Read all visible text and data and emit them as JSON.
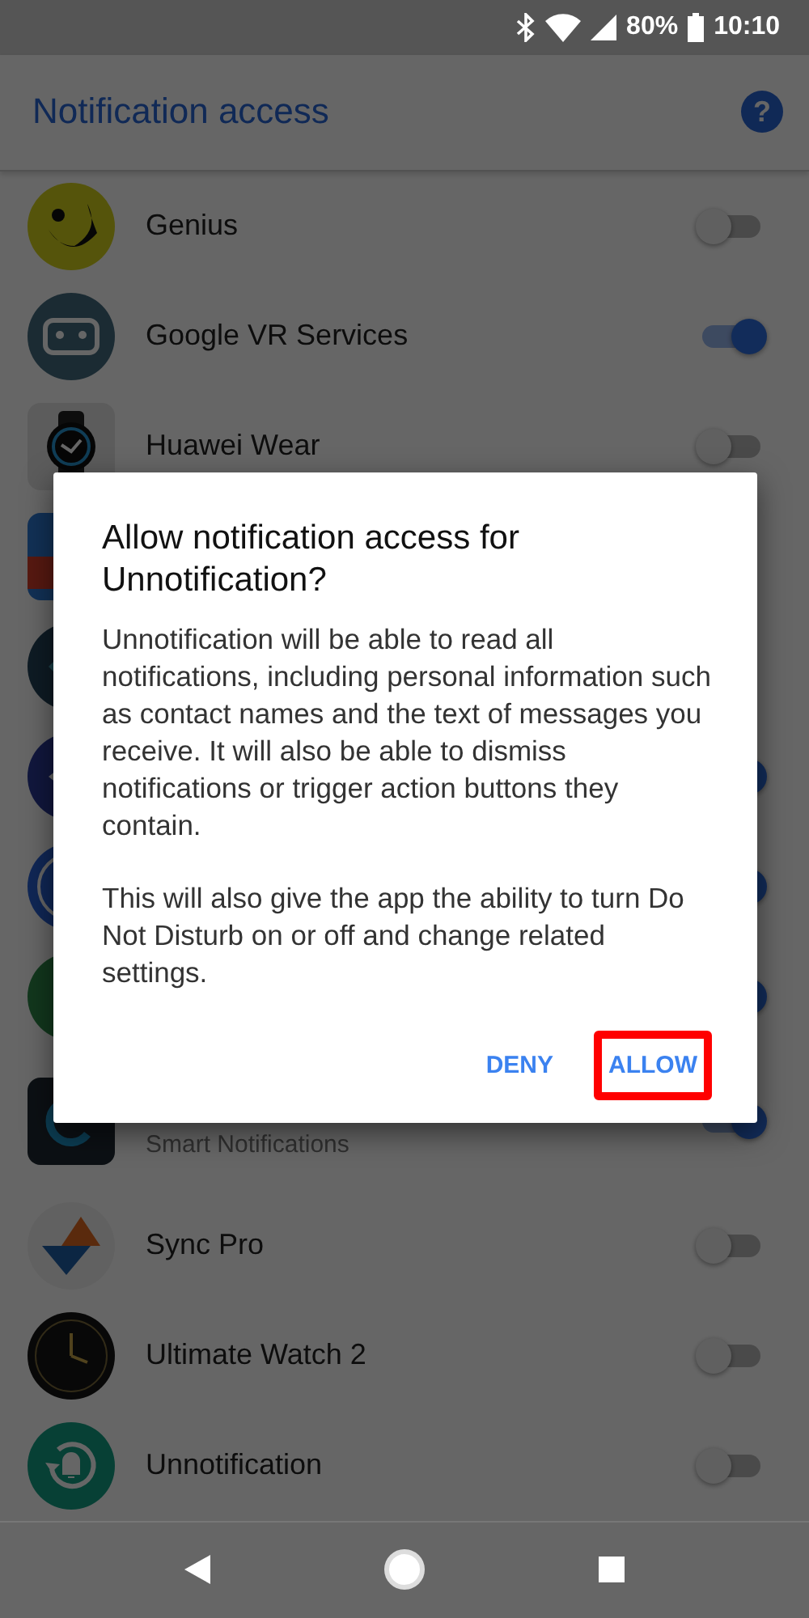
{
  "status_bar": {
    "battery": "80%",
    "time": "10:10"
  },
  "header": {
    "title": "Notification access",
    "help": "?"
  },
  "apps": [
    {
      "kind": "round",
      "name": "Genius",
      "on": false
    },
    {
      "kind": "round",
      "name": "Google VR Services",
      "on": true
    },
    {
      "kind": "square",
      "name": "Huawei Wear",
      "on": false
    },
    {
      "kind": "square"
    },
    {
      "kind": "round"
    },
    {
      "kind": "round",
      "on": true
    },
    {
      "kind": "round",
      "on": true
    },
    {
      "kind": "round",
      "on": true
    },
    {
      "kind": "square",
      "subtitle": "Smart Notifications",
      "on": true
    },
    {
      "kind": "round",
      "name": "Sync Pro",
      "on": false
    },
    {
      "kind": "round",
      "name": "Ultimate Watch 2",
      "on": false
    },
    {
      "kind": "round",
      "name": "Unnotification",
      "on": false
    }
  ],
  "dialog": {
    "title": "Allow notification access for Unnotification?",
    "paragraphs": [
      "Unnotification will be able to read all notifications, including personal information such as contact names and the text of messages you receive. It will also be able to dismiss notifications or trigger action buttons they contain.",
      "This will also give the app the ability to turn Do Not Disturb on or off and change related settings."
    ],
    "buttons": [
      {
        "label": "DENY",
        "highlighted": false
      },
      {
        "label": "ALLOW",
        "highlighted": true
      }
    ]
  }
}
